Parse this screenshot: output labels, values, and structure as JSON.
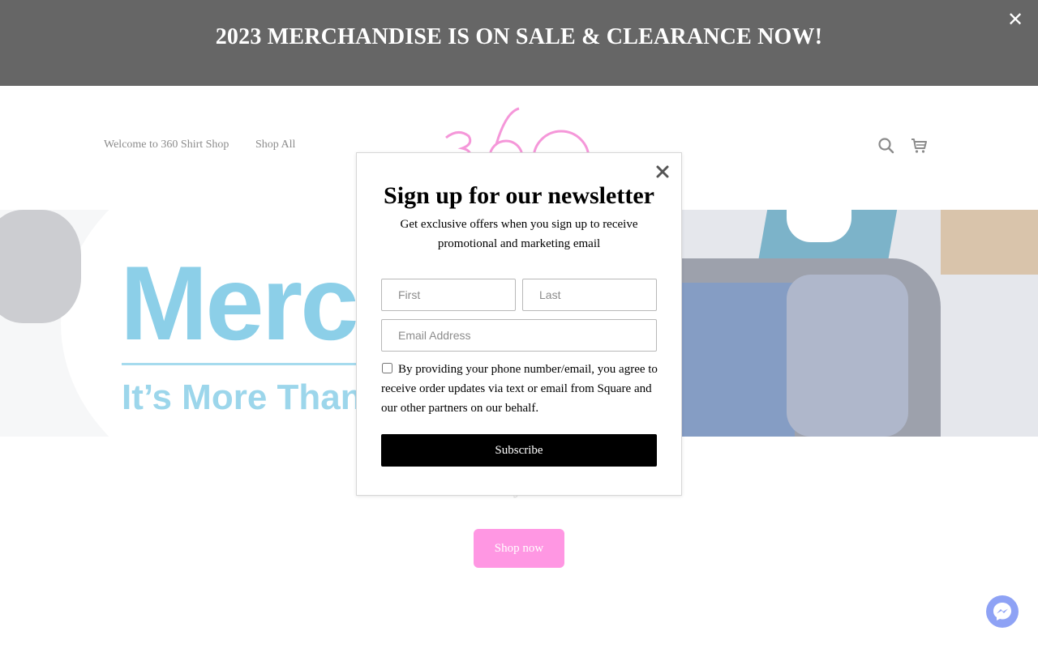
{
  "banner": {
    "text": "2023 MERCHANDISE IS ON SALE & CLEARANCE NOW!",
    "close_icon": "close-icon"
  },
  "header": {
    "nav": [
      {
        "label": "Welcome to 360 Shirt Shop"
      },
      {
        "label": "Shop All"
      }
    ],
    "logo_text": "360",
    "logo_color": "#f066c8",
    "icons": [
      "search-icon",
      "cart-icon"
    ]
  },
  "hero": {
    "title": "Merc",
    "subtitle": "It’s More Than"
  },
  "main": {
    "tagline": "y",
    "shop_button": "Shop now",
    "shop_button_color": "#ff66d6"
  },
  "newsletter": {
    "title": "Sign up for our newsletter",
    "description": "Get exclusive offers when you sign up to receive promotional and marketing email",
    "first_placeholder": "First",
    "last_placeholder": "Last",
    "email_placeholder": "Email Address",
    "consent_text": "By providing your phone number/email, you agree to receive order updates via text or email from Square and our other partners on our behalf.",
    "consent_checked": false,
    "subscribe_label": "Subscribe",
    "close_icon": "close-icon"
  },
  "chat": {
    "icon": "messenger-icon",
    "color": "#8ea2f5"
  }
}
